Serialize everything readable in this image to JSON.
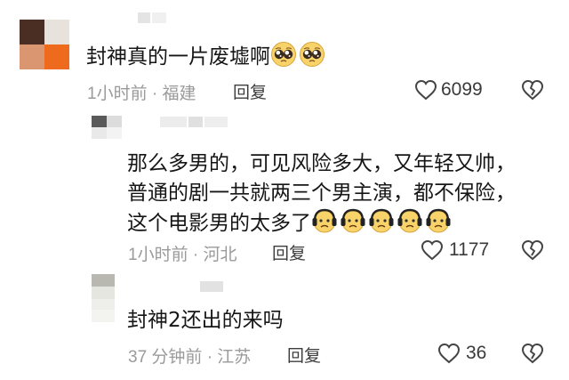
{
  "comments": [
    {
      "text": "封神真的一片废墟啊",
      "time_location": "1小时前 · 福建",
      "reply_label": "回复",
      "likes": "6099",
      "emoji": "pleading-face",
      "emoji_count": 2
    },
    {
      "lines": [
        "那么多男的，可见风险多大，又年轻又帅，",
        "普通的剧一共就两三个男主演，都不保险，",
        "这个电影男的太多了"
      ],
      "time_location": "1小时前 · 河北",
      "reply_label": "回复",
      "likes": "1177",
      "emoji": "headphones-worried-face",
      "emoji_count": 5
    },
    {
      "text": "封神2还出的来吗",
      "time_location": "37 分钟前 · 江苏",
      "reply_label": "回复",
      "likes": "36"
    }
  ],
  "icons": {
    "like": "heart-outline-icon",
    "dislike": "broken-heart-icon"
  },
  "colors": {
    "meta_gray": "#9a9a9a",
    "text": "#161616"
  }
}
